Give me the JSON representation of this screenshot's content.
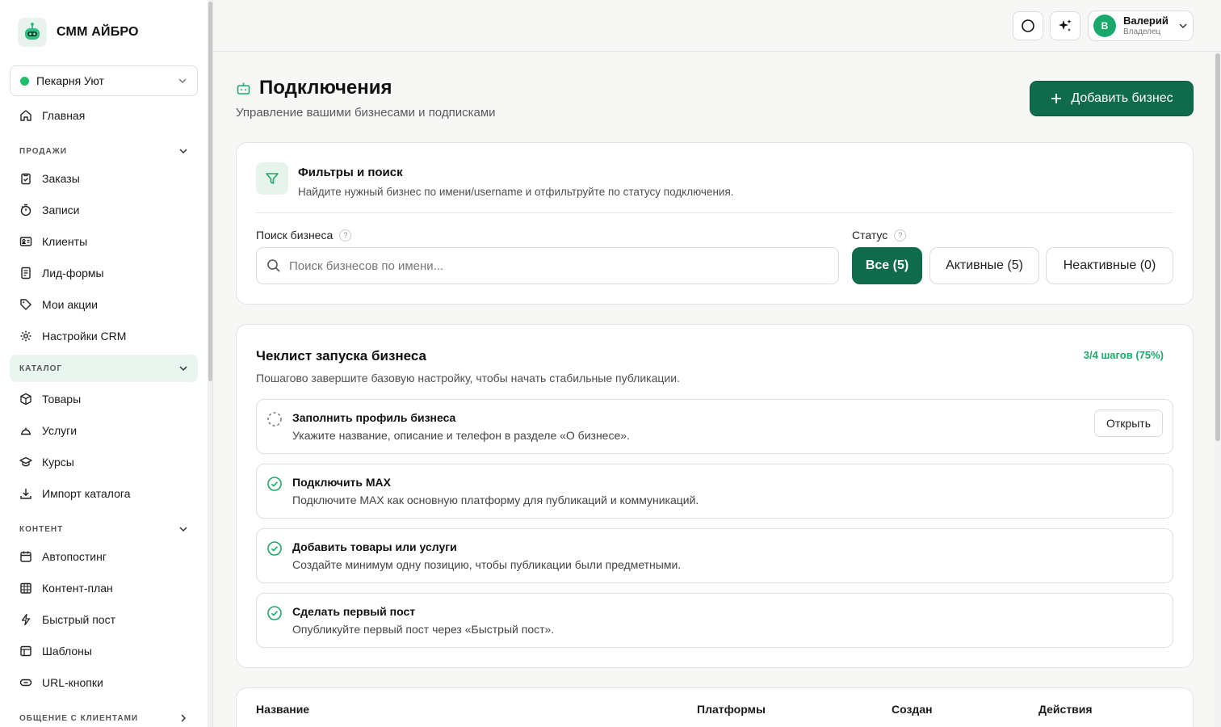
{
  "app": {
    "brand": "СММ АЙБРО"
  },
  "business_select": {
    "value": "Пекарня Уют"
  },
  "sidebar": {
    "home": "Главная",
    "sections": {
      "sales": "ПРОДАЖИ",
      "catalog": "КАТАЛОГ",
      "content": "КОНТЕНТ",
      "communication": "ОБЩЕНИЕ С КЛИЕНТАМИ"
    },
    "sales_items": [
      "Заказы",
      "Записи",
      "Клиенты",
      "Лид-формы",
      "Мои акции",
      "Настройки CRM"
    ],
    "catalog_items": [
      "Товары",
      "Услуги",
      "Курсы",
      "Импорт каталога"
    ],
    "content_items": [
      "Автопостинг",
      "Контент-план",
      "Быстрый пост",
      "Шаблоны",
      "URL-кнопки"
    ]
  },
  "user": {
    "initial": "В",
    "name": "Валерий",
    "role": "Владелец"
  },
  "page": {
    "title": "Подключения",
    "subtitle": "Управление вашими бизнесами и подписками",
    "add_button": "Добавить бизнес"
  },
  "filters": {
    "title": "Фильтры и поиск",
    "description": "Найдите нужный бизнес по имени/username и отфильтруйте по статусу подключения.",
    "search_label": "Поиск бизнеса",
    "search_placeholder": "Поиск бизнесов по имени...",
    "status_label": "Статус",
    "status_options": [
      "Все (5)",
      "Активные (5)",
      "Неактивные (0)"
    ],
    "status_selected": "Все (5)"
  },
  "checklist": {
    "title": "Чеклист запуска бизнеса",
    "progress": "3/4 шагов (75%)",
    "description": "Пошагово завершите базовую настройку, чтобы начать стабильные публикации.",
    "open_label": "Открыть",
    "steps": [
      {
        "title": "Заполнить профиль бизнеса",
        "desc": "Укажите название, описание и телефон в разделе «О бизнесе».",
        "done": false
      },
      {
        "title": "Подключить MAX",
        "desc": "Подключите MAX как основную платформу для публикаций и коммуникаций.",
        "done": true
      },
      {
        "title": "Добавить товары или услуги",
        "desc": "Создайте минимум одну позицию, чтобы публикации были предметными.",
        "done": true
      },
      {
        "title": "Сделать первый пост",
        "desc": "Опубликуйте первый пост через «Быстрый пост».",
        "done": true
      }
    ]
  },
  "table": {
    "columns": [
      "Название",
      "Платформы",
      "Создан",
      "Действия"
    ]
  },
  "colors": {
    "accent": "#0f6b4b",
    "success": "#1aa96a",
    "highlight_bg": "#e9f5ef"
  }
}
